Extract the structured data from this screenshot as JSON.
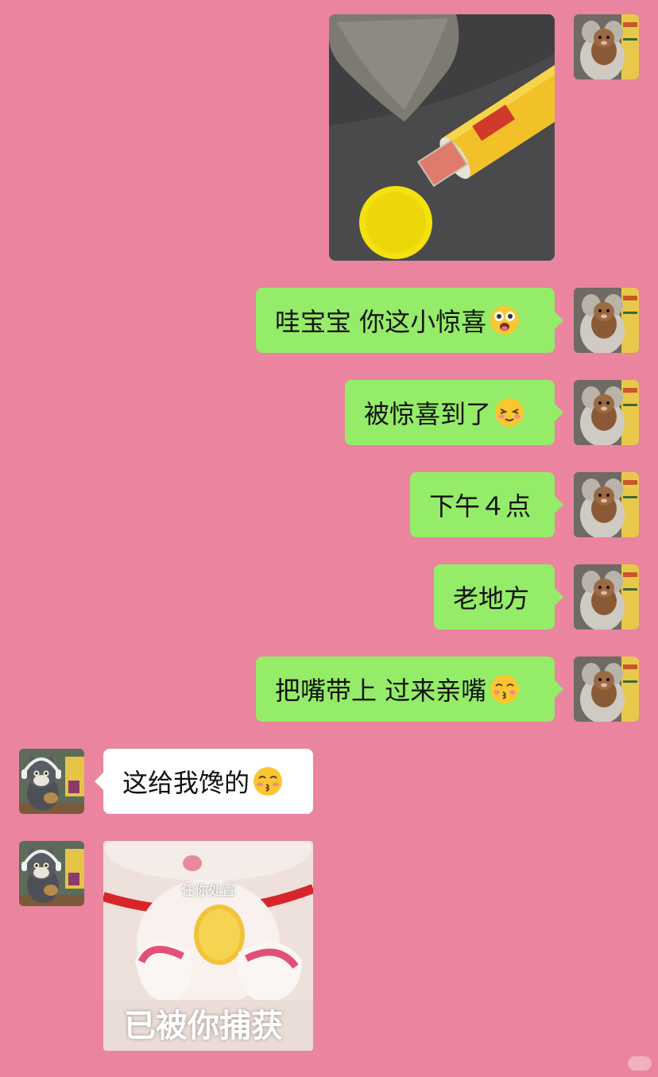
{
  "chat": {
    "messages": [
      {
        "id": "m1",
        "from": "me",
        "type": "image",
        "content": "photo of chip canister with rolled banknotes on grey sofa"
      },
      {
        "id": "m2",
        "from": "me",
        "type": "text",
        "text": "哇宝宝 你这小惊喜",
        "emoji": "starstruck-emoji"
      },
      {
        "id": "m3",
        "from": "me",
        "type": "text",
        "text": "被惊喜到了",
        "emoji": "blushing-smile-emoji"
      },
      {
        "id": "m4",
        "from": "me",
        "type": "text",
        "text": "下午４点"
      },
      {
        "id": "m5",
        "from": "me",
        "type": "text",
        "text": "老地方"
      },
      {
        "id": "m6",
        "from": "me",
        "type": "text",
        "text": "把嘴带上 过来亲嘴",
        "emoji": "kissing-emoji"
      },
      {
        "id": "m7",
        "from": "them",
        "type": "text",
        "text": "这给我馋的",
        "emoji": "kissing-emoji"
      },
      {
        "id": "m8",
        "from": "them",
        "type": "sticker",
        "caption_top": "任你处置",
        "caption_bottom": "已被你捕获"
      }
    ]
  },
  "colors": {
    "background": "#ea849f",
    "my_bubble": "#95ec69",
    "their_bubble": "#ffffff"
  }
}
